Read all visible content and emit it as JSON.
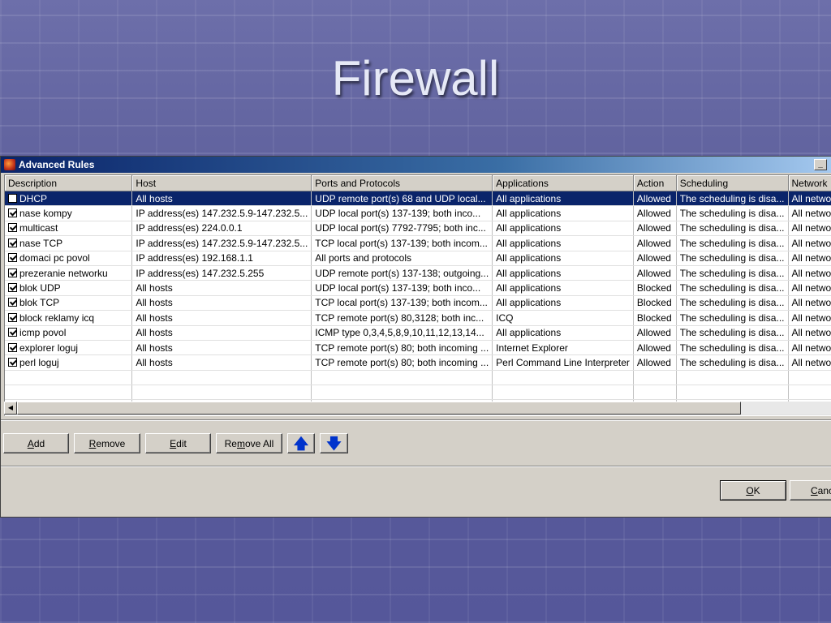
{
  "slide": {
    "title": "Firewall"
  },
  "dialog": {
    "title": "Advanced Rules",
    "minimize_glyph": "_",
    "columns": [
      "Description",
      "Host",
      "Ports and Protocols",
      "Applications",
      "Action",
      "Scheduling",
      "Network"
    ],
    "rows": [
      {
        "checked": false,
        "selected": true,
        "cells": [
          "DHCP",
          "All hosts",
          "UDP remote port(s) 68 and UDP local...",
          "All applications",
          "Allowed",
          "The scheduling is disa...",
          "All netwo"
        ]
      },
      {
        "checked": true,
        "selected": false,
        "cells": [
          "nase kompy",
          "IP address(es) 147.232.5.9-147.232.5...",
          "UDP local port(s) 137-139; both inco...",
          "All applications",
          "Allowed",
          "The scheduling is disa...",
          "All netwo"
        ]
      },
      {
        "checked": true,
        "selected": false,
        "cells": [
          "multicast",
          "IP address(es) 224.0.0.1",
          "UDP local port(s) 7792-7795; both inc...",
          "All applications",
          "Allowed",
          "The scheduling is disa...",
          "All netwo"
        ]
      },
      {
        "checked": true,
        "selected": false,
        "cells": [
          "nase TCP",
          "IP address(es) 147.232.5.9-147.232.5...",
          "TCP local port(s) 137-139; both incom...",
          "All applications",
          "Allowed",
          "The scheduling is disa...",
          "All netwo"
        ]
      },
      {
        "checked": true,
        "selected": false,
        "cells": [
          "domaci pc povol",
          "IP address(es) 192.168.1.1",
          "All ports and protocols",
          "All applications",
          "Allowed",
          "The scheduling is disa...",
          "All netwo"
        ]
      },
      {
        "checked": true,
        "selected": false,
        "cells": [
          "prezeranie networku",
          "IP address(es) 147.232.5.255",
          "UDP remote port(s) 137-138; outgoing...",
          "All applications",
          "Allowed",
          "The scheduling is disa...",
          "All netwo"
        ]
      },
      {
        "checked": true,
        "selected": false,
        "cells": [
          "blok UDP",
          "All hosts",
          "UDP local port(s) 137-139; both inco...",
          "All applications",
          "Blocked",
          "The scheduling is disa...",
          "All netwo"
        ]
      },
      {
        "checked": true,
        "selected": false,
        "cells": [
          "blok TCP",
          "All hosts",
          "TCP local port(s) 137-139; both incom...",
          "All applications",
          "Blocked",
          "The scheduling is disa...",
          "All netwo"
        ]
      },
      {
        "checked": true,
        "selected": false,
        "cells": [
          "block reklamy icq",
          "All hosts",
          "TCP remote port(s) 80,3128; both inc...",
          "ICQ",
          "Blocked",
          "The scheduling is disa...",
          "All netwo"
        ]
      },
      {
        "checked": true,
        "selected": false,
        "cells": [
          "icmp povol",
          "All hosts",
          "ICMP type 0,3,4,5,8,9,10,11,12,13,14...",
          "All applications",
          "Allowed",
          "The scheduling is disa...",
          "All netwo"
        ]
      },
      {
        "checked": true,
        "selected": false,
        "cells": [
          "explorer loguj",
          "All hosts",
          "TCP remote port(s) 80; both incoming ...",
          "Internet Explorer",
          "Allowed",
          "The scheduling is disa...",
          "All netwo"
        ]
      },
      {
        "checked": true,
        "selected": false,
        "cells": [
          "perl loguj",
          "All hosts",
          "TCP remote port(s) 80; both incoming ...",
          "Perl Command Line Interpreter",
          "Allowed",
          "The scheduling is disa...",
          "All netwo"
        ]
      }
    ],
    "empty_rows": 3,
    "buttons": {
      "add": {
        "accel": "A",
        "rest": "dd"
      },
      "remove": {
        "accel": "R",
        "rest": "emove"
      },
      "edit": {
        "accel": "E",
        "rest": "dit"
      },
      "remove_all_pre": "Re",
      "remove_all_accel": "m",
      "remove_all_post": "ove All",
      "up_glyph": "🡅",
      "down_glyph": "🡇",
      "ok": {
        "accel": "O",
        "rest": "K"
      },
      "cancel": {
        "accel": "C",
        "rest": "ancel"
      }
    },
    "icons": {
      "app": "firewall-app-icon",
      "up": "arrow-up-icon",
      "down": "arrow-down-icon",
      "scroll_left": "scroll-left-arrow-icon"
    }
  }
}
